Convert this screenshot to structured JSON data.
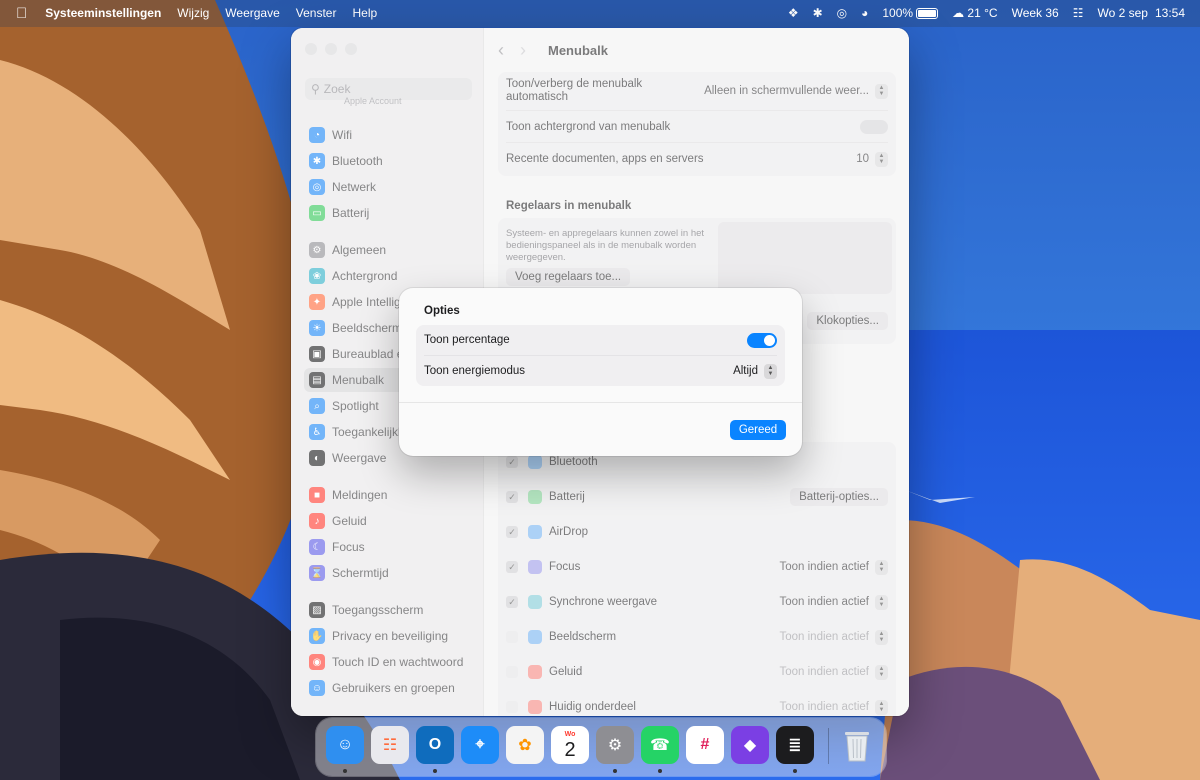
{
  "menubar": {
    "app": "Systeeminstellingen",
    "menus": [
      "Wijzig",
      "Weergave",
      "Venster",
      "Help"
    ],
    "battery_percent": "100%",
    "weather": "21 °C",
    "week": "Week 36",
    "date": "Wo 2 sep",
    "time": "13:54"
  },
  "sidebar": {
    "search_placeholder": "Zoek",
    "account_label": "Apple Account",
    "items": [
      {
        "label": "Wifi",
        "color": "#1e88f5"
      },
      {
        "label": "Bluetooth",
        "color": "#1e88f5"
      },
      {
        "label": "Netwerk",
        "color": "#1e88f5"
      },
      {
        "label": "Batterij",
        "color": "#34c759"
      },
      {
        "label": "Algemeen",
        "color": "#8e8e93"
      },
      {
        "label": "Achtergrond",
        "color": "#30b0c7"
      },
      {
        "label": "Apple Intelligence",
        "color": "#ff6b3d"
      },
      {
        "label": "Beeldscherm",
        "color": "#1e88f5"
      },
      {
        "label": "Bureaublad en Dock",
        "color": "#1c1c1e"
      },
      {
        "label": "Menubalk",
        "color": "#1c1c1e"
      },
      {
        "label": "Spotlight",
        "color": "#1e88f5"
      },
      {
        "label": "Toegankelijkheid",
        "color": "#1e88f5"
      },
      {
        "label": "Weergave",
        "color": "#1c1c1e"
      },
      {
        "label": "Meldingen",
        "color": "#ff3b30"
      },
      {
        "label": "Geluid",
        "color": "#ff3b30"
      },
      {
        "label": "Focus",
        "color": "#5e5ce6"
      },
      {
        "label": "Schermtijd",
        "color": "#5e5ce6"
      },
      {
        "label": "Toegangsscherm",
        "color": "#1c1c1e"
      },
      {
        "label": "Privacy en beveiliging",
        "color": "#1e88f5"
      },
      {
        "label": "Touch ID en wachtwoord",
        "color": "#ff3b30"
      },
      {
        "label": "Gebruikers en groepen",
        "color": "#1e88f5"
      }
    ]
  },
  "content": {
    "title": "Menubalk",
    "settings": {
      "autohide_label": "Toon/verberg de menubalk automatisch",
      "autohide_value": "Alleen in schermvullende weer...",
      "background_label": "Toon achtergrond van menubalk",
      "recent_label": "Recente documenten, apps en servers",
      "recent_value": "10"
    },
    "controls_section": {
      "heading": "Regelaars in menubalk",
      "description": "Systeem- en appregelaars kunnen zowel in het bedieningspaneel als in de menubalk worden weergegeven.",
      "add_button": "Voeg regelaars toe...",
      "clock_button": "Klokopties..."
    },
    "list": [
      {
        "label": "Bluetooth",
        "checked": true,
        "color": "#1e88f5",
        "value": ""
      },
      {
        "label": "Batterij",
        "checked": true,
        "color": "#34c759",
        "value": "",
        "button": "Batterij-opties..."
      },
      {
        "label": "AirDrop",
        "checked": true,
        "color": "#1e88f5",
        "value": ""
      },
      {
        "label": "Focus",
        "checked": true,
        "color": "#5e5ce6",
        "value": "Toon indien actief"
      },
      {
        "label": "Synchrone weergave",
        "checked": true,
        "color": "#30b0c7",
        "value": "Toon indien actief"
      },
      {
        "label": "Beeldscherm",
        "checked": false,
        "color": "#1e88f5",
        "value": "Toon indien actief"
      },
      {
        "label": "Geluid",
        "checked": false,
        "color": "#ff3b30",
        "value": "Toon indien actief"
      },
      {
        "label": "Huidig onderdeel",
        "checked": false,
        "color": "#ff3b30",
        "value": "Toon indien actief"
      }
    ]
  },
  "sheet": {
    "title": "Opties",
    "show_percentage_label": "Toon percentage",
    "show_percentage_on": true,
    "energy_mode_label": "Toon energiemodus",
    "energy_mode_value": "Altijd",
    "done_button": "Gereed"
  },
  "dock": {
    "apps": [
      {
        "name": "finder",
        "color": "#2f8ff0"
      },
      {
        "name": "launchpad",
        "color": "#e9e9ee"
      },
      {
        "name": "outlook",
        "color": "#0f6cbd"
      },
      {
        "name": "safari",
        "color": "#1d8cf8"
      },
      {
        "name": "photos",
        "color": "#f4f4f4"
      },
      {
        "name": "calendar",
        "color": "#ffffff",
        "text_top": "Wo",
        "text_main": "2"
      },
      {
        "name": "system-settings",
        "color": "#8e8e93"
      },
      {
        "name": "whatsapp",
        "color": "#25d366"
      },
      {
        "name": "slack",
        "color": "#ffffff"
      },
      {
        "name": "shortcuts",
        "color": "#7b3fe4"
      },
      {
        "name": "app-store-like",
        "color": "#1c1c1e"
      }
    ],
    "trash": {
      "name": "trash"
    }
  }
}
